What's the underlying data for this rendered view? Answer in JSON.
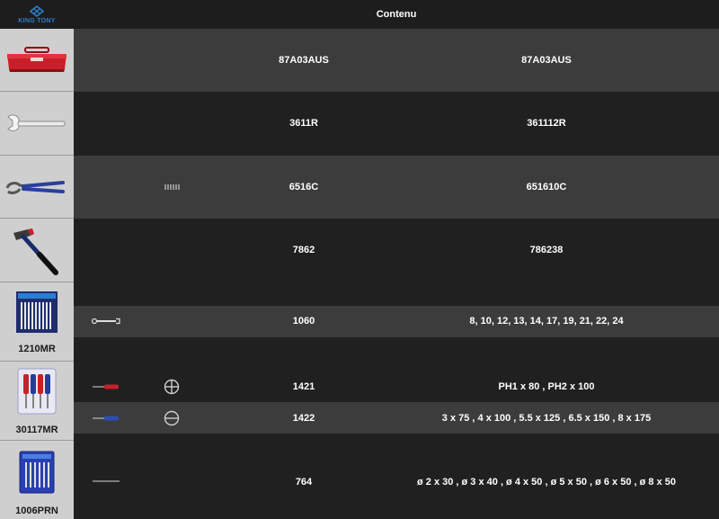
{
  "header": {
    "brand": "KING TONY",
    "title": "Contenu"
  },
  "rows": [
    {
      "code": "87A03AUS",
      "spec": "87A03AUS"
    },
    {
      "code": "3611R",
      "spec": "361112R"
    },
    {
      "code": "6516C",
      "spec": "651610C"
    },
    {
      "code": "7862",
      "spec": "786238"
    },
    {
      "set_label": "1210MR",
      "code": "1060",
      "spec": "8, 10, 12, 13, 14, 17, 19, 21, 22, 24"
    },
    {
      "set_label": "30117MR",
      "code": "1421",
      "spec": "PH1 x 80 , PH2 x 100"
    },
    {
      "code": "1422",
      "spec": "3 x 75 , 4 x 100 , 5.5 x 125 , 6.5 x 150 , 8 x 175"
    },
    {
      "set_label": "1006PRN",
      "code": "764",
      "spec": "ø 2 x 30 , ø 3 x 40 , ø 4 x 50 , ø 5 x 50 , ø 6 x 50 , ø 8 x 50"
    }
  ],
  "colors": {
    "header_bg": "#1d1d1d",
    "band_light": "#3c3c3c",
    "band_dark": "#202020",
    "brand_blue": "#2a7fd0",
    "toolbox_red": "#c8202a"
  },
  "icons": [
    "king-tony-logo",
    "toolbox-red",
    "adjustable-wrench",
    "water-pump-pliers",
    "hammer",
    "wrench-set",
    "screwdriver-set",
    "pin-punch-set",
    "spring-icon",
    "wrench-small-icon",
    "phillips-icon",
    "slotted-icon",
    "punch-small-icon"
  ]
}
